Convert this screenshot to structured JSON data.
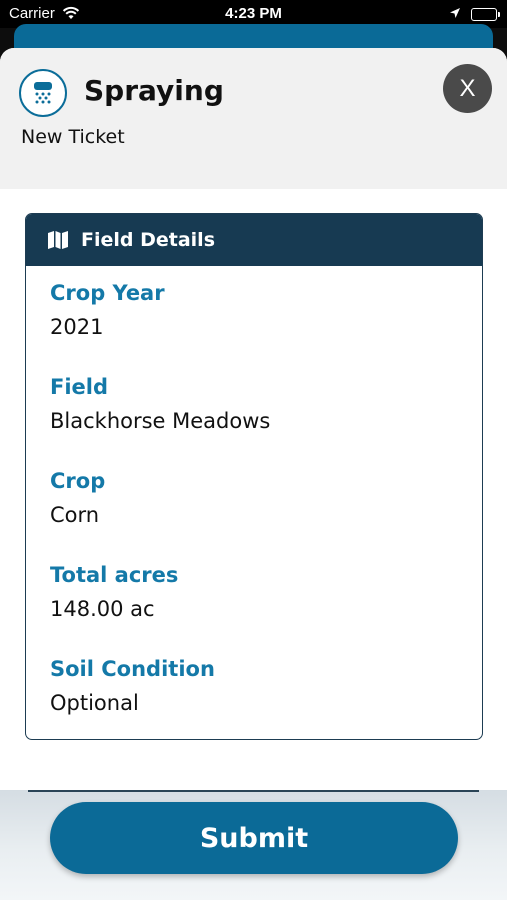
{
  "status_bar": {
    "carrier": "Carrier",
    "time": "4:23 PM"
  },
  "header": {
    "icon": "spray-icon",
    "title": "Spraying",
    "subtitle": "New Ticket",
    "close_label": "X"
  },
  "card": {
    "icon": "map-icon",
    "title": "Field Details",
    "fields": [
      {
        "label": "Crop Year",
        "value": "2021"
      },
      {
        "label": "Field",
        "value": "Blackhorse Meadows"
      },
      {
        "label": "Crop",
        "value": "Corn"
      },
      {
        "label": "Total acres",
        "value": "148.00 ac"
      },
      {
        "label": "Soil Condition",
        "value": "Optional"
      }
    ]
  },
  "footer": {
    "submit_label": "Submit"
  },
  "colors": {
    "accent": "#0b6a97",
    "card_header": "#173a52",
    "label": "#1479a8",
    "close_button": "#4a4a4a"
  }
}
